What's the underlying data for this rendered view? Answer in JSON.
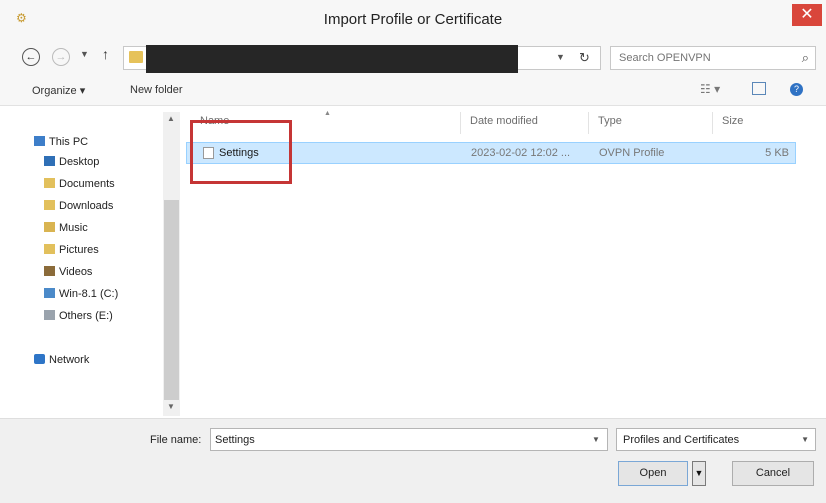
{
  "window": {
    "title": "Import Profile or Certificate",
    "close_glyph": "✕"
  },
  "navbar": {
    "search_placeholder": "Search OPENVPN",
    "icons": [
      "back-icon",
      "forward-icon",
      "chevron-down-icon",
      "up-arrow-icon",
      "folder-icon",
      "refresh-icon",
      "search-icon"
    ]
  },
  "toolbar": {
    "organize_label": "Organize ▾",
    "new_folder_label": "New folder"
  },
  "sidebar": {
    "items": [
      {
        "label": "This PC",
        "icon": "computer-icon"
      },
      {
        "label": "Desktop",
        "icon": "desktop-icon"
      },
      {
        "label": "Documents",
        "icon": "documents-icon"
      },
      {
        "label": "Downloads",
        "icon": "downloads-icon"
      },
      {
        "label": "Music",
        "icon": "music-icon"
      },
      {
        "label": "Pictures",
        "icon": "pictures-icon"
      },
      {
        "label": "Videos",
        "icon": "videos-icon"
      },
      {
        "label": "Win-8.1 (C:)",
        "icon": "drive-icon"
      },
      {
        "label": "Others (E:)",
        "icon": "drive-icon"
      },
      {
        "label": "Network",
        "icon": "network-icon"
      }
    ]
  },
  "files": {
    "columns": [
      "Name",
      "Date modified",
      "Type",
      "Size"
    ],
    "rows": [
      {
        "name": "Settings",
        "date": "2023-02-02 12:02 ...",
        "type": "OVPN Profile",
        "size": "5 KB"
      }
    ]
  },
  "footer": {
    "file_name_label": "File name:",
    "file_name_value": "Settings",
    "file_type": "Profiles and Certificates",
    "open_label": "Open",
    "cancel_label": "Cancel"
  },
  "colors": {
    "selection": "#cce8ff",
    "highlight_box": "#c53535",
    "close_button": "#d9463b"
  }
}
